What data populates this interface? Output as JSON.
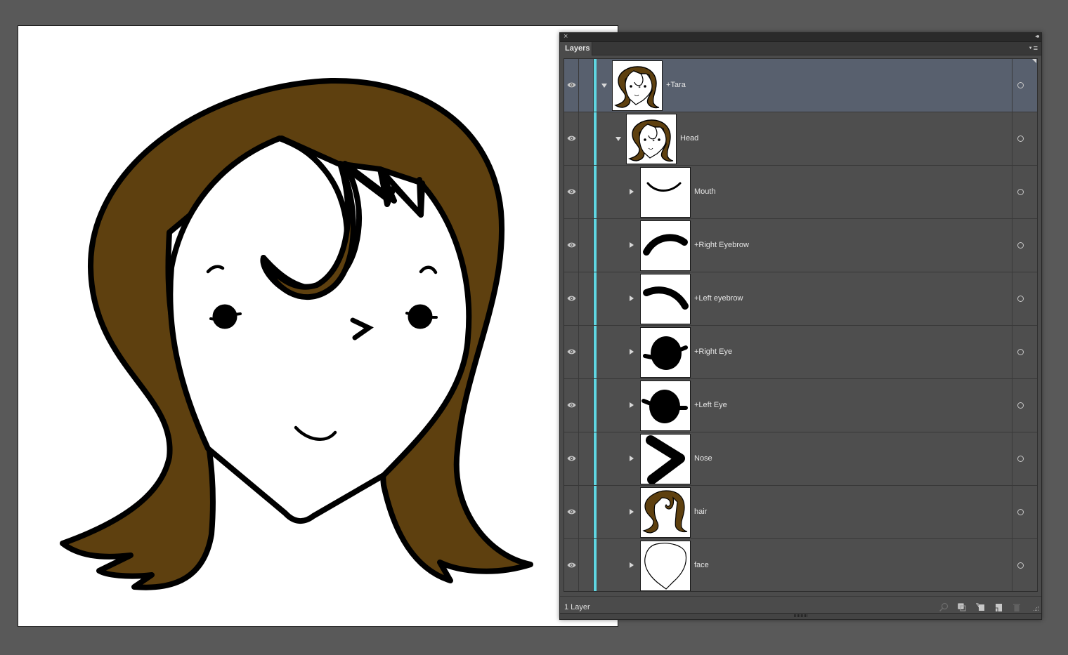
{
  "canvas": {
    "artwork_name": "Tara",
    "colors": {
      "hair": "#5e400f",
      "outline": "#000000",
      "skin": "#ffffff",
      "pasteboard": "#595959"
    }
  },
  "panel": {
    "close_glyph": "×",
    "collapse_glyph": "◂◂",
    "tab_label": "Layers",
    "menu_glyph": "≡",
    "layer_count": "1 Layer",
    "selection_color": "#5fd6e2",
    "layers": [
      {
        "name": "+Tara",
        "level": 0,
        "expanded": true,
        "visible": true,
        "selected": true,
        "thumb": "full-face"
      },
      {
        "name": "Head",
        "level": 1,
        "expanded": true,
        "visible": true,
        "selected": false,
        "thumb": "full-face"
      },
      {
        "name": "Mouth",
        "level": 2,
        "expanded": false,
        "visible": true,
        "selected": false,
        "thumb": "mouth"
      },
      {
        "name": "+Right Eyebrow",
        "level": 2,
        "expanded": false,
        "visible": true,
        "selected": false,
        "thumb": "right-eyebrow"
      },
      {
        "name": "+Left eyebrow",
        "level": 2,
        "expanded": false,
        "visible": true,
        "selected": false,
        "thumb": "left-eyebrow"
      },
      {
        "name": "+Right Eye",
        "level": 2,
        "expanded": false,
        "visible": true,
        "selected": false,
        "thumb": "right-eye"
      },
      {
        "name": "+Left Eye",
        "level": 2,
        "expanded": false,
        "visible": true,
        "selected": false,
        "thumb": "left-eye"
      },
      {
        "name": "Nose",
        "level": 2,
        "expanded": false,
        "visible": true,
        "selected": false,
        "thumb": "nose"
      },
      {
        "name": "hair",
        "level": 2,
        "expanded": false,
        "visible": true,
        "selected": false,
        "thumb": "hair"
      },
      {
        "name": "face",
        "level": 2,
        "expanded": false,
        "visible": true,
        "selected": false,
        "thumb": "face"
      }
    ],
    "footer_icons": [
      "locate-object-icon",
      "make-clipping-mask-icon",
      "create-sublayer-icon",
      "create-new-layer-icon",
      "delete-icon"
    ]
  }
}
